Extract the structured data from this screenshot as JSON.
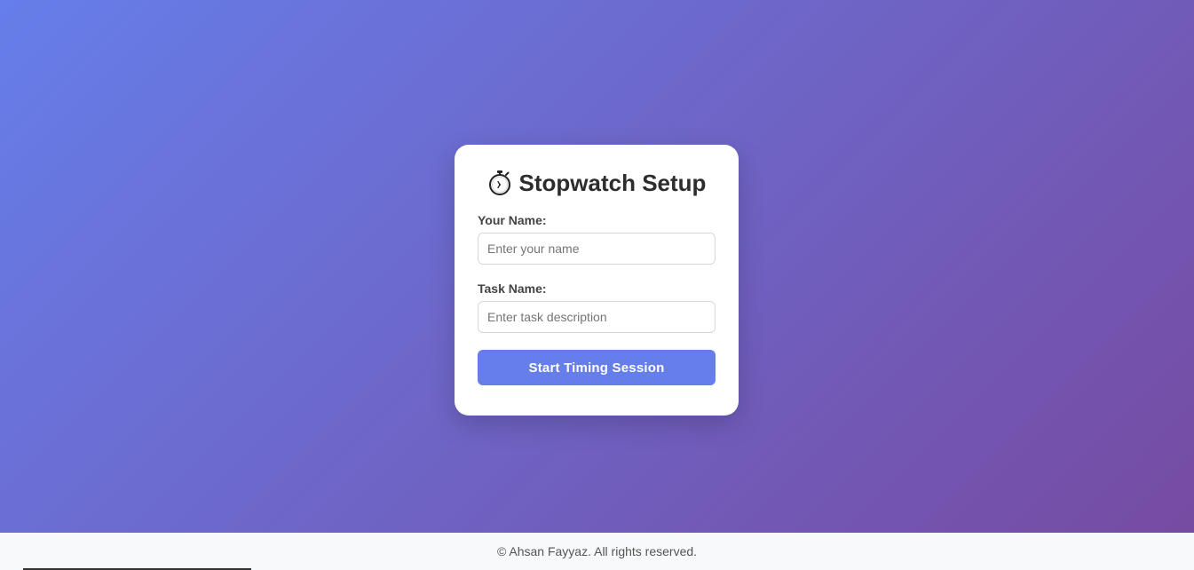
{
  "setup": {
    "title": "Stopwatch Setup",
    "title_icon": "stopwatch-icon",
    "name_label": "Your Name:",
    "name_placeholder": "Enter your name",
    "name_value": "",
    "task_label": "Task Name:",
    "task_placeholder": "Enter task description",
    "task_value": "",
    "start_button": "Start Timing Session"
  },
  "footer": {
    "text": "© Ahsan Fayyaz. All rights reserved."
  },
  "colors": {
    "gradient_start": "#667eea",
    "gradient_end": "#764ba2",
    "button": "#667eea",
    "footer_bg": "#f8f9fa"
  }
}
